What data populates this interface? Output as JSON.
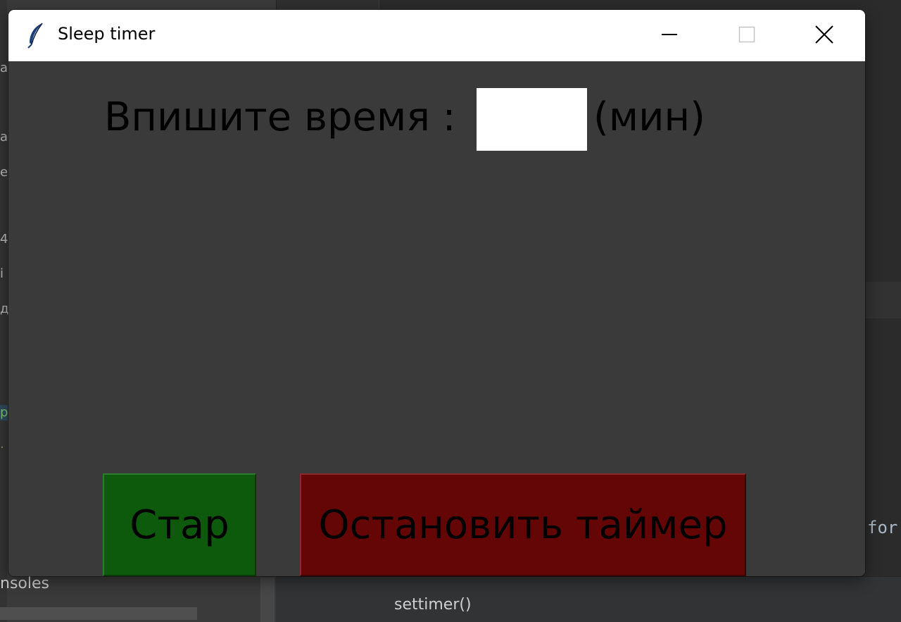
{
  "ide": {
    "left_fragments": [
      "a",
      "a",
      "e",
      "4",
      "i",
      "д",
      "p",
      "."
    ],
    "consoles_label": "nsoles",
    "editor_call": "settimer()",
    "editor_keyword": "for"
  },
  "window": {
    "title": "Sleep timer",
    "icon": "feather-icon",
    "controls": {
      "minimize": "minimize-icon",
      "maximize": "maximize-icon",
      "close": "close-icon"
    }
  },
  "form": {
    "prompt_label": "Впишите время :",
    "time_value": "",
    "unit_label": "(мин)"
  },
  "buttons": {
    "start_label": "Стар",
    "stop_label": "Остановить таймер"
  },
  "colors": {
    "content_bg": "#3a3a3a",
    "start_bg": "#0d5a0d",
    "stop_bg": "#640606",
    "titlebar_bg": "#ffffff"
  }
}
